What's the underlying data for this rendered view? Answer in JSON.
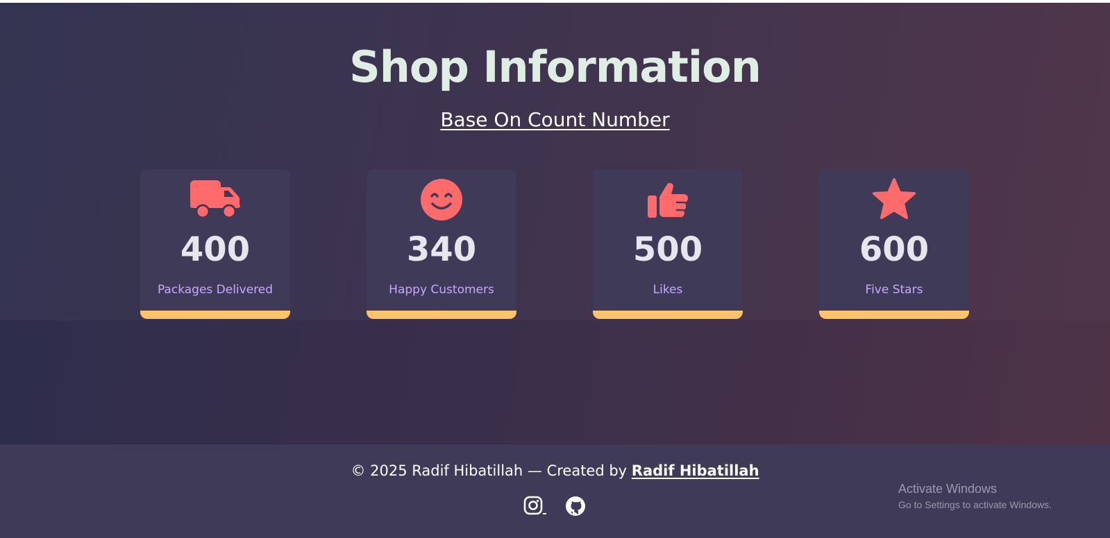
{
  "page": {
    "title": "Shop Information",
    "subtitle": "Base On Count Number"
  },
  "stats": [
    {
      "icon": "truck-icon",
      "number": "400",
      "label": "Packages Delivered"
    },
    {
      "icon": "smile-icon",
      "number": "340",
      "label": "Happy Customers"
    },
    {
      "icon": "thumbs-up-icon",
      "number": "500",
      "label": "Likes"
    },
    {
      "icon": "star-icon",
      "number": "600",
      "label": "Five Stars"
    }
  ],
  "footer": {
    "copyright": "© 2025 Radif Hibatillah — Created by ",
    "author_link": "Radif Hibatillah",
    "social": [
      "instagram-icon",
      "github-icon"
    ]
  },
  "overlay": {
    "activate_title": "Activate Windows",
    "activate_sub": "Go to Settings to activate Windows."
  },
  "colors": {
    "icon_accent": "#ff6b6b",
    "bar_accent": "#ffc46b",
    "label_color": "#c7a9ff",
    "title_color": "#dfeee3",
    "card_bg": "#3e3a57"
  }
}
